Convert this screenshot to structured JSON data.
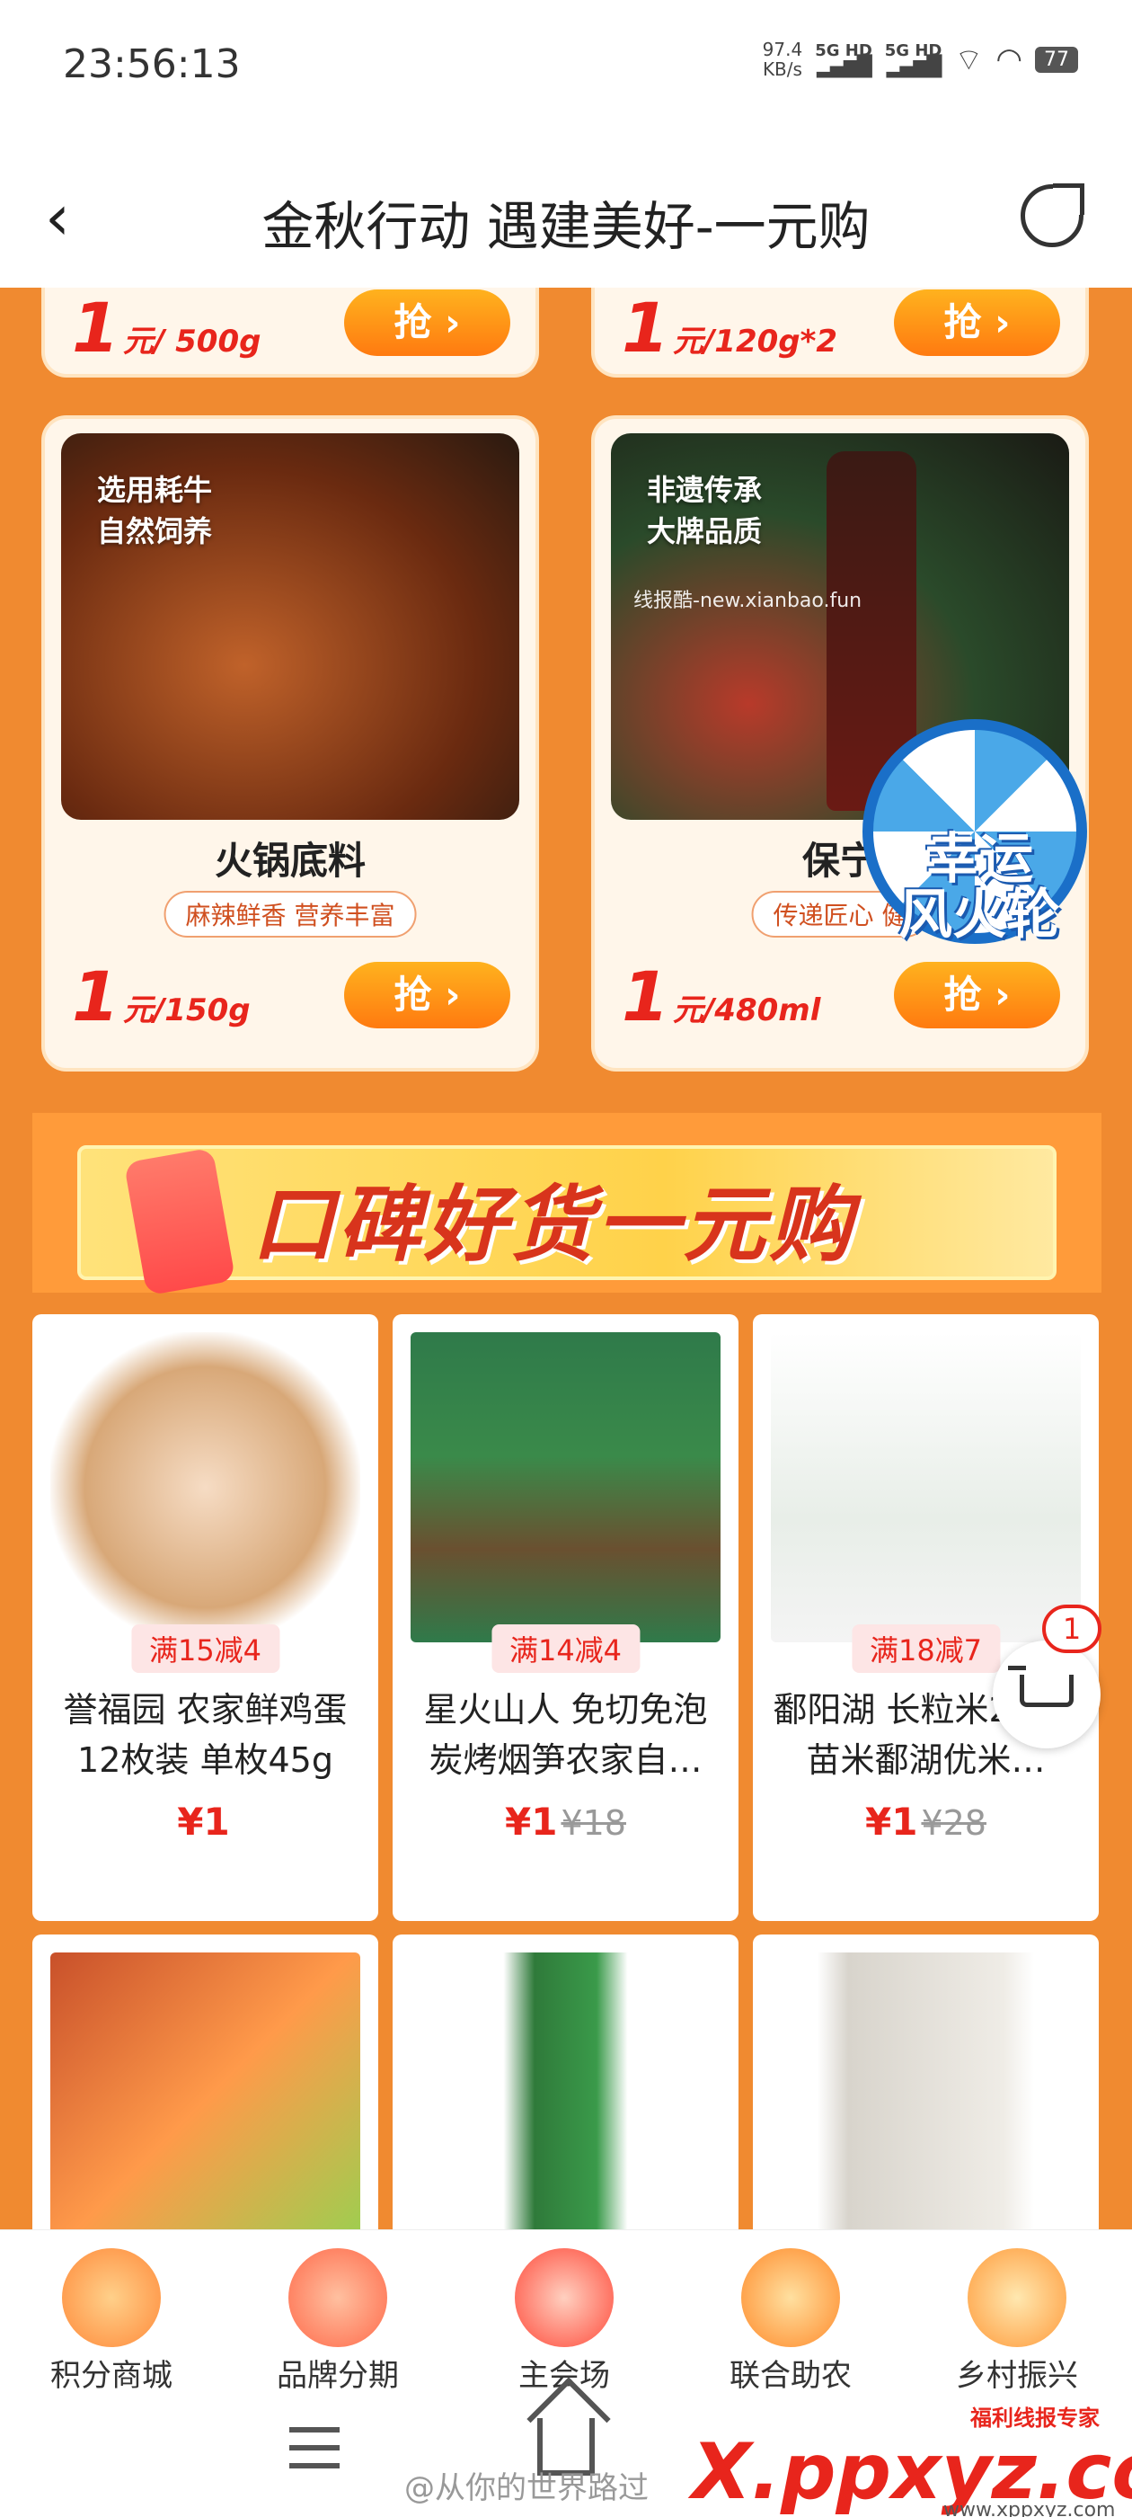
{
  "status": {
    "time": "23:56:13",
    "netspeed": "97.4",
    "netunit": "KB/s",
    "sig1": "5G HD",
    "sig2": "5G HD",
    "battery": "77"
  },
  "nav": {
    "title": "金秋行动 遇建美好-一元购"
  },
  "top_cards": [
    {
      "price_big": "1",
      "price_unit": "元",
      "spec": "/ 500g",
      "button": "抢"
    },
    {
      "price_big": "1",
      "price_unit": "元",
      "spec": "/120g*2",
      "button": "抢"
    }
  ],
  "feature_cards": [
    {
      "tagline1": "选用耗牛",
      "tagline2": "自然饲养",
      "name": "火锅底料",
      "sub": "麻辣鲜香 营养丰富",
      "price_big": "1",
      "price_unit": "元",
      "spec": "/150g",
      "button": "抢",
      "img_color": "#8a3a14"
    },
    {
      "tagline1": "非遗传承",
      "tagline2": "大牌品质",
      "name": "保宁",
      "sub": "传递匠心 健",
      "price_big": "1",
      "price_unit": "元",
      "spec": "/480ml",
      "button": "抢",
      "img_color": "#2a3a22",
      "watermark": "线报酷-new.xianbao.fun"
    }
  ],
  "wheel": {
    "line1": "幸运",
    "line2": "风火轮"
  },
  "banner": {
    "title": "口碑好货一元购"
  },
  "products": [
    {
      "promo": "满15减4",
      "name": "誉福园 农家鲜鸡蛋12枚装 单枚45g",
      "price": "¥1",
      "orig": "",
      "img_color": "#f1d3b6"
    },
    {
      "promo": "满14减4",
      "name": "星火山人 免切免泡炭烤烟笋农家自…",
      "price": "¥1",
      "orig": "¥18",
      "img_color": "#4a8a4a"
    },
    {
      "promo": "满18减7",
      "name": "鄱阳湖 长粒米2斤丝苗米鄱湖优米…",
      "price": "¥1",
      "orig": "¥28",
      "img_color": "#e6efe6"
    },
    {
      "promo": "",
      "name": "",
      "price": "",
      "orig": "",
      "img_color": "#ffb04a"
    },
    {
      "promo": "",
      "name": "",
      "price": "",
      "orig": "",
      "img_color": "#2f7a3a"
    },
    {
      "promo": "",
      "name": "",
      "price": "",
      "orig": "",
      "img_color": "#e6e2da"
    }
  ],
  "cart": {
    "badge": "1"
  },
  "tabs": [
    {
      "label": "积分商城",
      "color": "#ffb15a"
    },
    {
      "label": "品牌分期",
      "color": "#ff8a6a"
    },
    {
      "label": "主会场",
      "color": "#ff5a4a"
    },
    {
      "label": "联合助农",
      "color": "#ff9a3a"
    },
    {
      "label": "乡村振兴",
      "color": "#ffa84a"
    }
  ],
  "footer": {
    "weibo": "@从你的世界路过",
    "brand": "福利线报专家",
    "site": "X.ppxyz.com",
    "site_sub": "www.xppxyz.com"
  }
}
